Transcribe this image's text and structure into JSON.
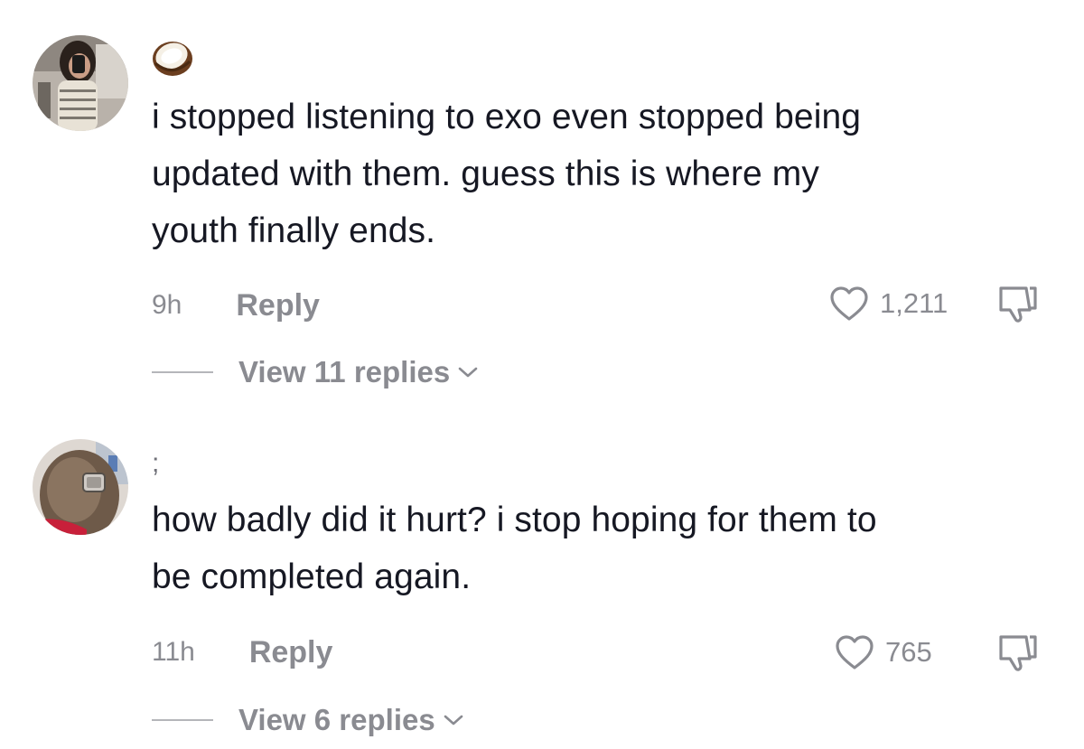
{
  "comments": [
    {
      "username": "🥥",
      "avatar_icon": "avatar-photo-icon",
      "text_lines": [
        "i stopped listening to exo even stopped being",
        "updated with them. guess this is where my",
        "youth finally ends."
      ],
      "time": "9h",
      "reply_label": "Reply",
      "likes": "1,211",
      "view_replies": "View 11 replies"
    },
    {
      "username": ";",
      "avatar_icon": "avatar-photo-icon",
      "text_lines": [
        "how badly did it hurt? i stop hoping for them to",
        "be completed again."
      ],
      "time": "11h",
      "reply_label": "Reply",
      "likes": "765",
      "view_replies": "View 6 replies"
    }
  ],
  "colors": {
    "text": "#161823",
    "muted": "#8a8b91",
    "background": "#ffffff"
  }
}
